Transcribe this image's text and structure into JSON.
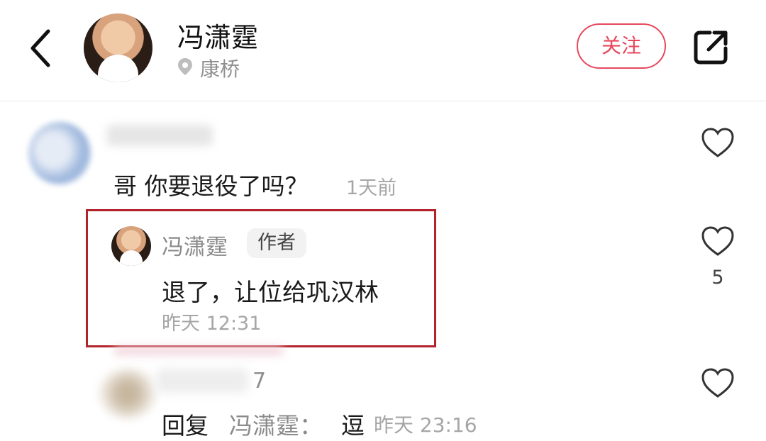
{
  "header": {
    "user_name": "冯潇霆",
    "location": "康桥",
    "follow_label": "关注",
    "icons": {
      "back": "chevron-left-icon",
      "share": "share-icon",
      "location": "location-pin-icon"
    }
  },
  "comments": [
    {
      "text": "哥 你要退役了吗？",
      "time": "1天前"
    }
  ],
  "reply": {
    "author": "冯潇霆",
    "badge": "作者",
    "text": "退了，让位给巩汉林",
    "time": "昨天 12:31",
    "likes": "5"
  },
  "comment3": {
    "name_tail": "7",
    "reply_prefix": "回复",
    "reply_to": "冯潇霆：",
    "reply_body": "逗",
    "time": "昨天 23:16"
  },
  "colors": {
    "accent": "#e6485d",
    "highlight_border": "#b3232b",
    "muted_text": "#a6a6a6"
  }
}
